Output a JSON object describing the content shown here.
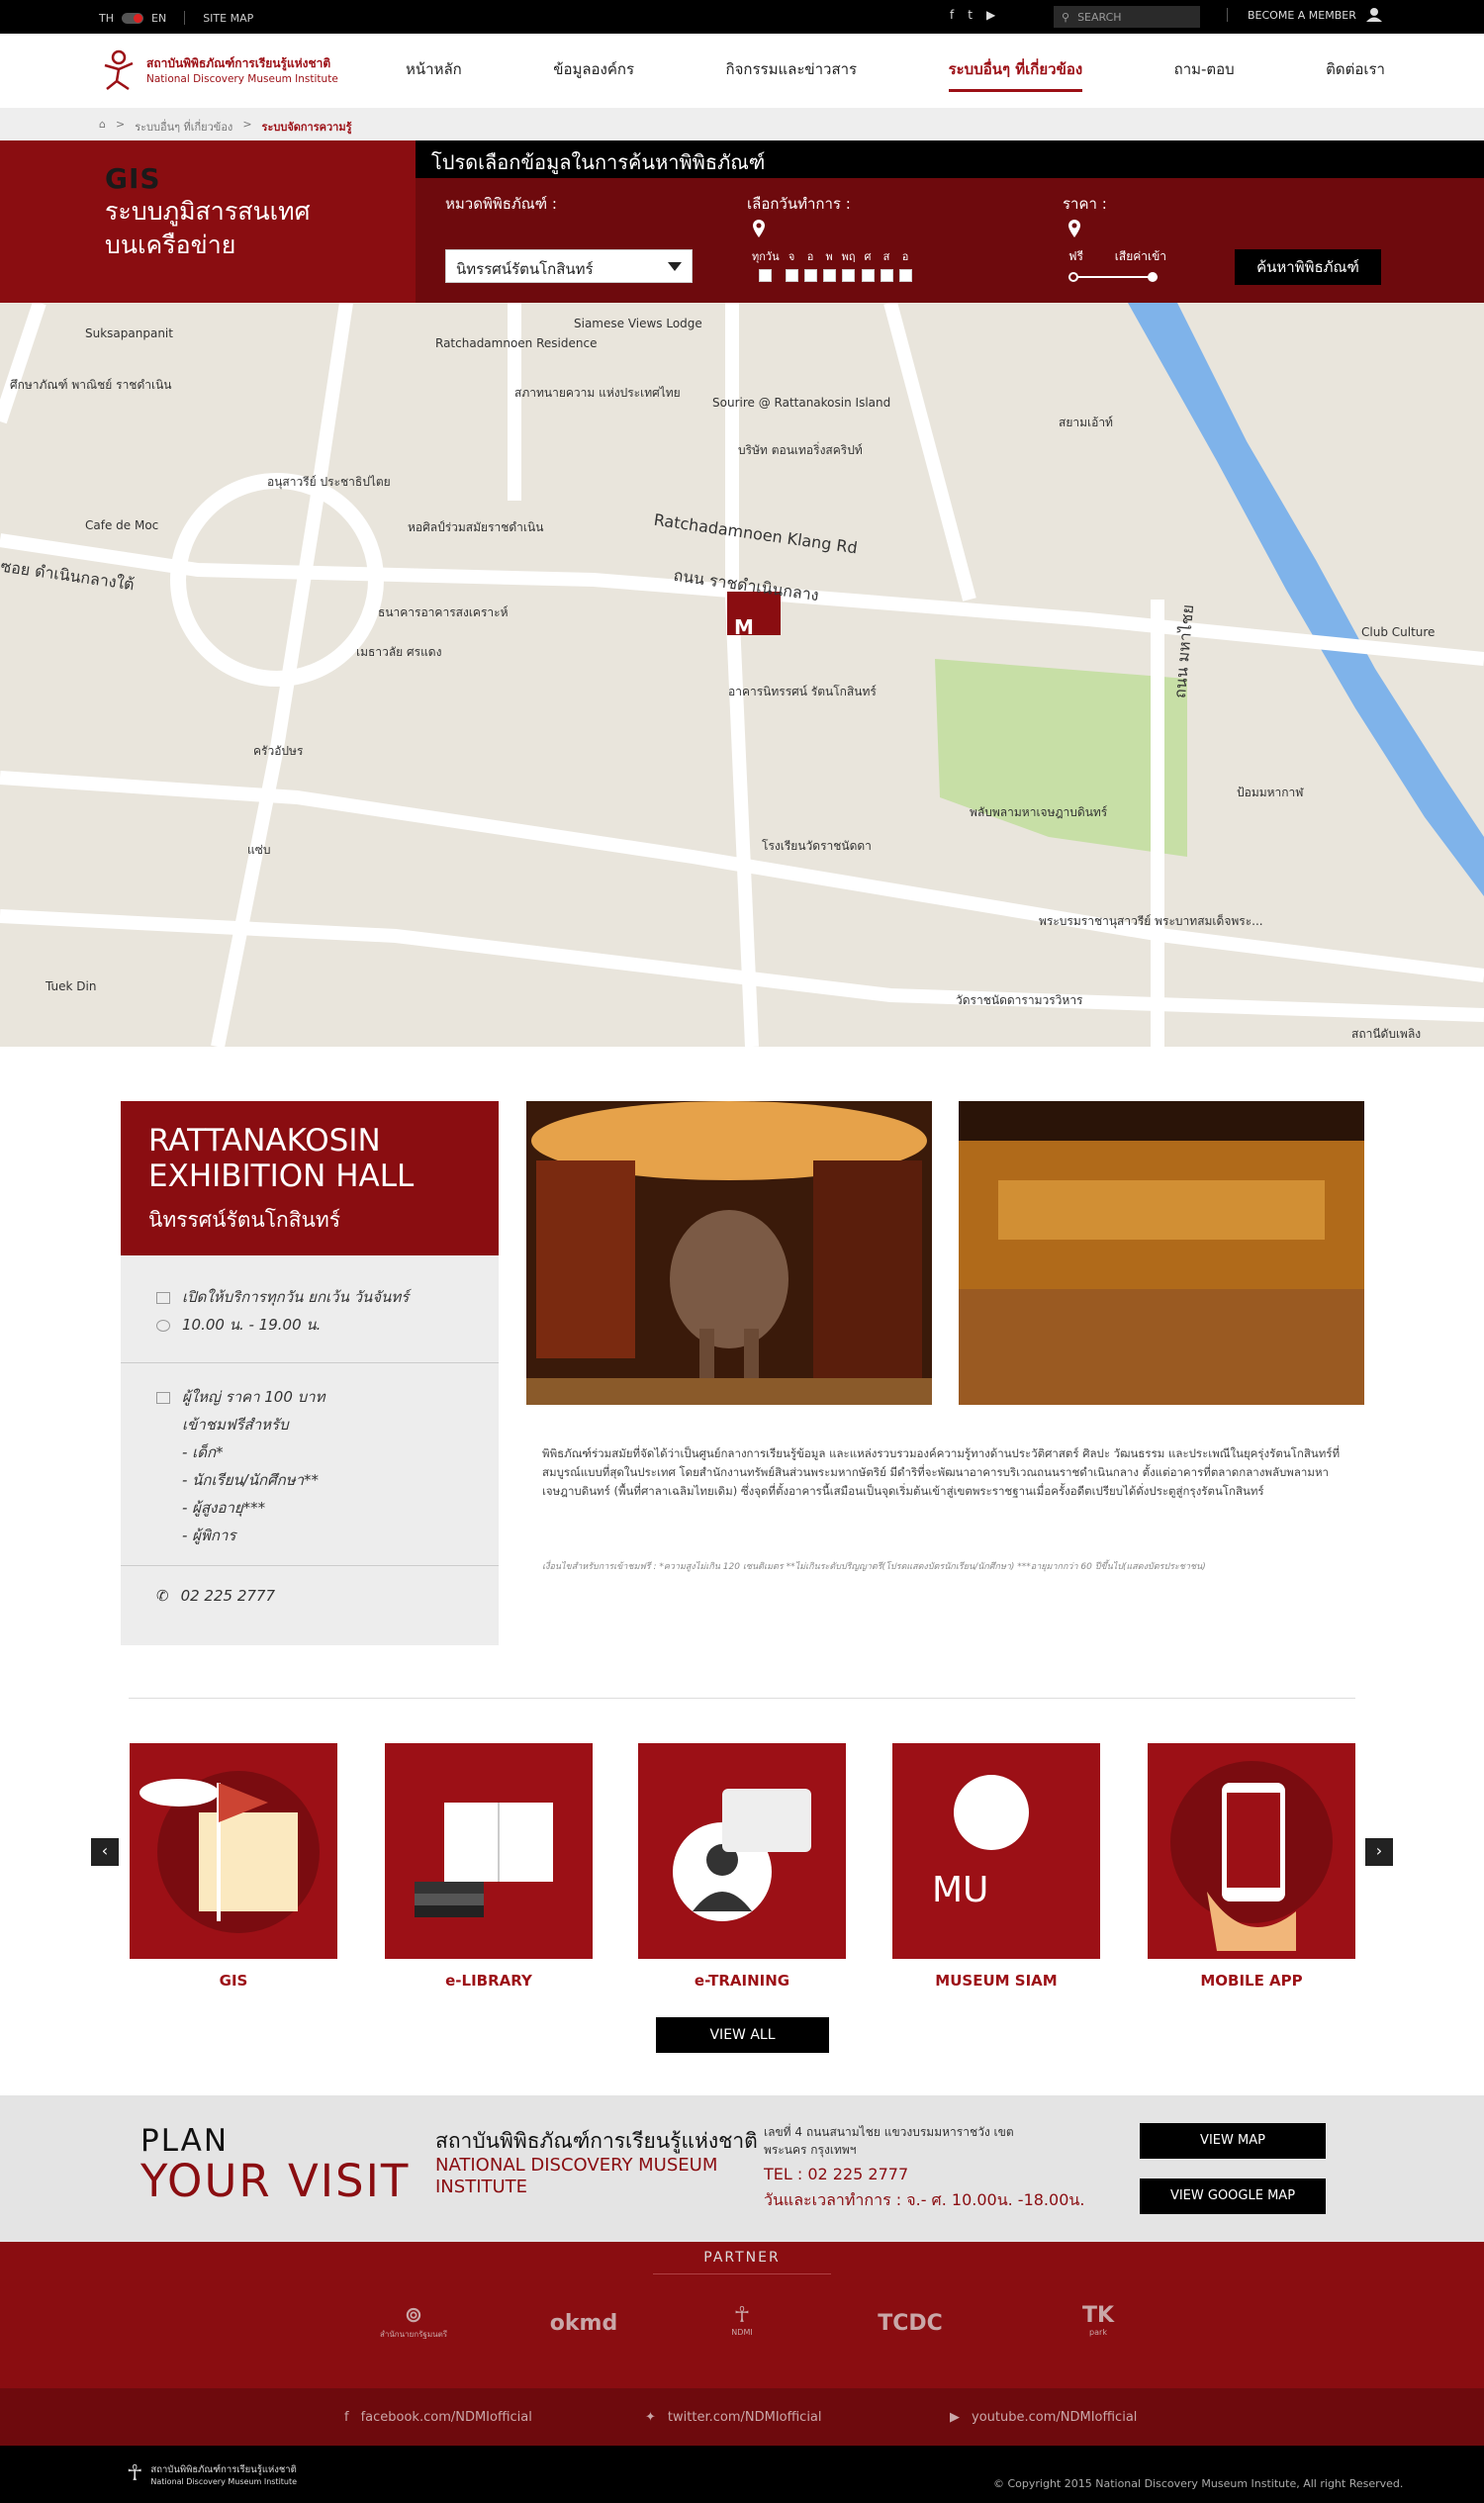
{
  "topbar": {
    "lang_th": "TH",
    "lang_en": "EN",
    "sitemap": "SITE MAP",
    "search_placeholder": "SEARCH",
    "member": "BECOME A MEMBER"
  },
  "logo": {
    "th": "สถาบันพิพิธภัณฑ์การเรียนรู้แห่งชาติ",
    "en": "National Discovery Museum Institute"
  },
  "nav": [
    {
      "label": "หน้าหลัก"
    },
    {
      "label": "ข้อมูลองค์กร"
    },
    {
      "label": "กิจกรรมและข่าวสาร"
    },
    {
      "label": "ระบบอื่นๆ ที่เกี่ยวข้อง"
    },
    {
      "label": "ถาม-ตอบ"
    },
    {
      "label": "ติดต่อเรา"
    }
  ],
  "breadcrumb": [
    "ระบบอื่นๆ ที่เกี่ยวข้อง",
    "ระบบจัดการความรู้"
  ],
  "gis": {
    "title": "GIS",
    "subtitle1": "ระบบภูมิสารสนเทศ",
    "subtitle2": "บนเครือข่าย"
  },
  "form": {
    "heading": "โปรดเลือกข้อมูลในการค้นหาพิพิธภัณฑ์",
    "category_label": "หมวดพิพิธภัณฑ์ :",
    "category_value": "นิทรรศน์รัตนโกสินทร์",
    "days_label": "เลือกวันทำการ :",
    "days": [
      "ทุกวัน",
      "จ",
      "อ",
      "พ",
      "พฤ",
      "ศ",
      "ส",
      "อ"
    ],
    "price_label": "ราคา :",
    "price_free": "ฟรี",
    "price_paid": "เสียค่าเข้า",
    "search_button": "ค้นหาพิพิธภัณฑ์"
  },
  "map": {
    "marker": "M",
    "labels": [
      "Suksapanpanit",
      "Siamese Views Lodge",
      "Ratchadamnoen Residence",
      "สภาทนายความ แห่งประเทศไทย",
      "ศึกษาภัณฑ์ พาณิชย์ ราชดำเนิน",
      "Sourire @ Rattanakosin Island",
      "อนุสาวรีย์ ประชาธิปไตย",
      "Cafe de Moc",
      "หอศิลป์ร่วมสมัยราชดำเนิน",
      "บริษัท ตอนเทอริ่งสคริปท์",
      "สยามเอ้าท์",
      "Ratchadamnoen Klang Rd",
      "ถนน ราชดำเนินกลาง",
      "ซอย ดำเนินกลางใต้",
      "ธนาคารอาคารสงเคราะห์",
      "เมธาวลัย ศรแดง",
      "อาคารนิทรรศน์ รัตนโกสินทร์",
      "ถนน มหาไชย",
      "Club Culture",
      "ครัวอัปษร",
      "แซ่บ",
      "พลับพลามหาเจษฎาบดินทร์",
      "โรงเรียนวัดราชนัดดา",
      "พระบรมราชานุสาวรีย์ พระบาทสมเด็จพระ...",
      "วัดราชนัดดารามวรวิหาร",
      "Tuek Din",
      "ป้อมมหากาฬ",
      "สถานีดับเพลิง"
    ]
  },
  "hall": {
    "title_en_1": "RATTANAKOSIN",
    "title_en_2": "EXHIBITION HALL",
    "title_th": "นิทรรศน์รัตนโกสินทร์",
    "open": "เปิดให้บริการทุกวัน ยกเว้น วันจันทร์",
    "time": "10.00 น. - 19.00 น.",
    "price": "ผู้ใหญ่ ราคา 100 บาท",
    "free_for": "เข้าชมฟรีสำหรับ",
    "free_list": [
      "- เด็ก*",
      "- นักเรียน/นักศึกษา**",
      "- ผู้สูงอายุ***",
      "- ผู้พิการ"
    ],
    "phone": "02 225 2777",
    "description": "พิพิธภัณฑ์ร่วมสมัยที่จัดได้ว่าเป็นศูนย์กลางการเรียนรู้ข้อมูล และแหล่งรวบรวมองค์ความรู้ทางด้านประวัติศาสตร์ ศิลปะ วัฒนธรรม และประเพณีในยุครุ่งรัตนโกสินทร์ที่สมบูรณ์แบบที่สุดในประเทศ โดยสำนักงานทรัพย์สินส่วนพระมหากษัตริย์ มีดำริที่จะพัฒนาอาคารบริเวณถนนราชดำเนินกลาง ตั้งแต่อาคารที่ตลาดกลางพลับพลามหาเจษฎาบดินทร์ (พื้นที่ศาลาเฉลิมไทยเดิม) ซึ่งจุดที่ตั้งอาคารนี้เสมือนเป็นจุดเริ่มต้นเข้าสู่เขตพระราชฐานเมื่อครั้งอดีตเปรียบได้ดั่งประตูสู่กรุงรัตนโกสินทร์",
    "note": "เงื่อนไขสำหรับการเข้าชมฟรี : *ความสูงไม่เกิน 120 เซนติเมตร **ไม่เกินระดับปริญญาตรี(โปรดแสดงบัตรนักเรียน/นักศึกษา) ***อายุมากกว่า 60 ปีขึ้นไป(แสดงบัตรประชาชน)"
  },
  "tiles": [
    {
      "label": "GIS"
    },
    {
      "label": "e-LIBRARY"
    },
    {
      "label": "e-TRAINING"
    },
    {
      "label": "MUSEUM SIAM"
    },
    {
      "label": "MOBILE APP"
    }
  ],
  "view_all": "VIEW ALL",
  "plan": {
    "line1": "PLAN",
    "line2": "YOUR VISIT",
    "name_th": "สถาบันพิพิธภัณฑ์การเรียนรู้แห่งชาติ",
    "name_en": "NATIONAL DISCOVERY MUSEUM INSTITUTE",
    "address": "เลขที่ 4 ถนนสนามไชย แขวงบรมมหาราชวัง เขตพระนคร กรุงเทพฯ",
    "tel": "TEL : 02 225 2777",
    "hours": "วันและเวลาทำการ : จ.- ศ. 10.00น. -18.00น.",
    "view_map": "VIEW MAP",
    "view_google_map": "VIEW GOOGLE MAP"
  },
  "partner": {
    "heading": "PARTNER",
    "logos": [
      {
        "name": "",
        "caption": "สำนักนายกรัฐมนตรี"
      },
      {
        "name": "okmd",
        "caption": ""
      },
      {
        "name": "",
        "caption": "NDMI"
      },
      {
        "name": "TCDC",
        "caption": ""
      },
      {
        "name": "TK",
        "caption": "park"
      }
    ]
  },
  "social": {
    "facebook": "facebook.com/NDMIofficial",
    "twitter": "twitter.com/NDMIofficial",
    "youtube": "youtube.com/NDMIofficial"
  },
  "footer": {
    "logo_th": "สถาบันพิพิธภัณฑ์การเรียนรู้แห่งชาติ",
    "logo_en": "National Discovery Museum Institute",
    "copyright": "© Copyright 2015 National Discovery Museum Institute, All right Reserved."
  },
  "colors": {
    "brand": "#8a0d11",
    "brand_light": "#9c1016"
  }
}
